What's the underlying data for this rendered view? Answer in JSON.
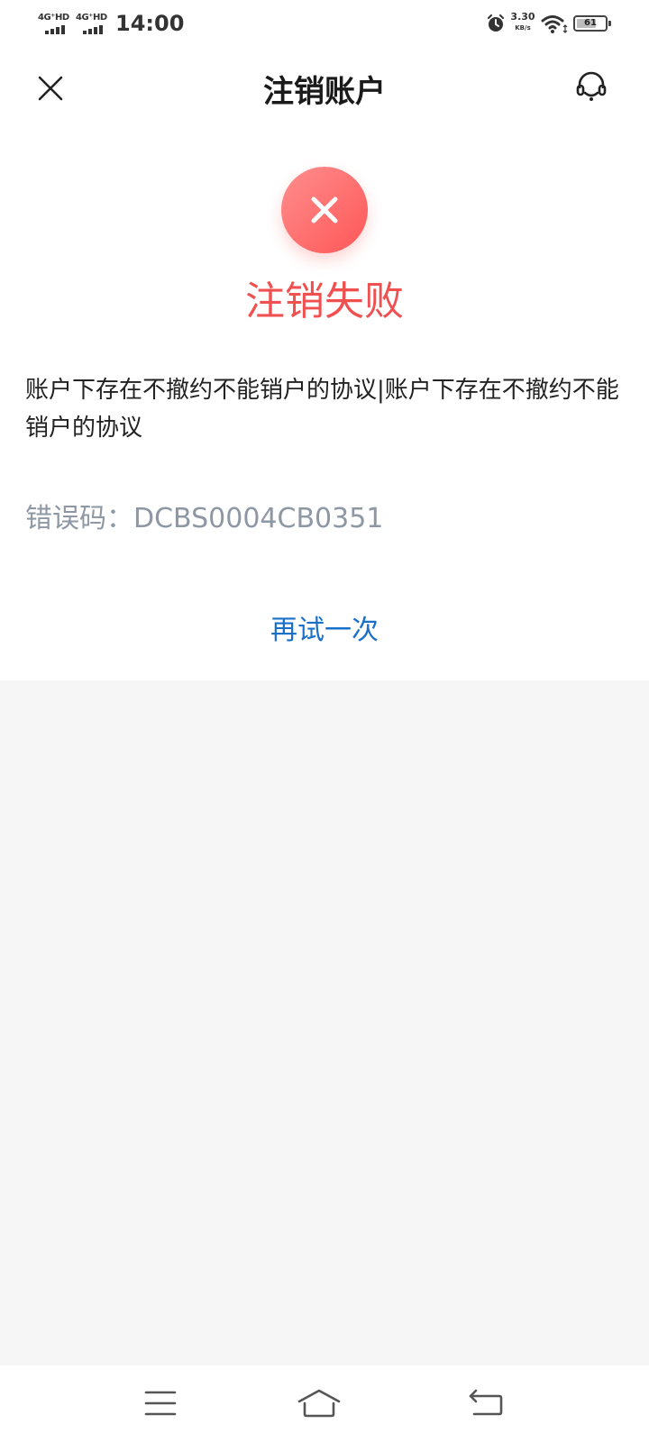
{
  "status_bar": {
    "sim1": "4G⁺HD",
    "sim2": "4G⁺HD",
    "time": "14:00",
    "net_speed": "3.30",
    "net_speed_unit": "KB/s",
    "battery": "61"
  },
  "header": {
    "title": "注销账户"
  },
  "result": {
    "title": "注销失败",
    "message": "账户下存在不撤约不能销户的协议|账户下存在不撤约不能销户的协议",
    "error_label": "错误码：",
    "error_code": "DCBS0004CB0351",
    "retry_label": "再试一次"
  },
  "icons": {
    "close": "close-icon",
    "support": "headset-icon",
    "fail": "x-icon",
    "menu": "menu-icon",
    "home": "home-icon",
    "back": "back-icon"
  },
  "colors": {
    "error": "#f05050",
    "link": "#1a6fc9",
    "muted": "#8e97a4"
  }
}
